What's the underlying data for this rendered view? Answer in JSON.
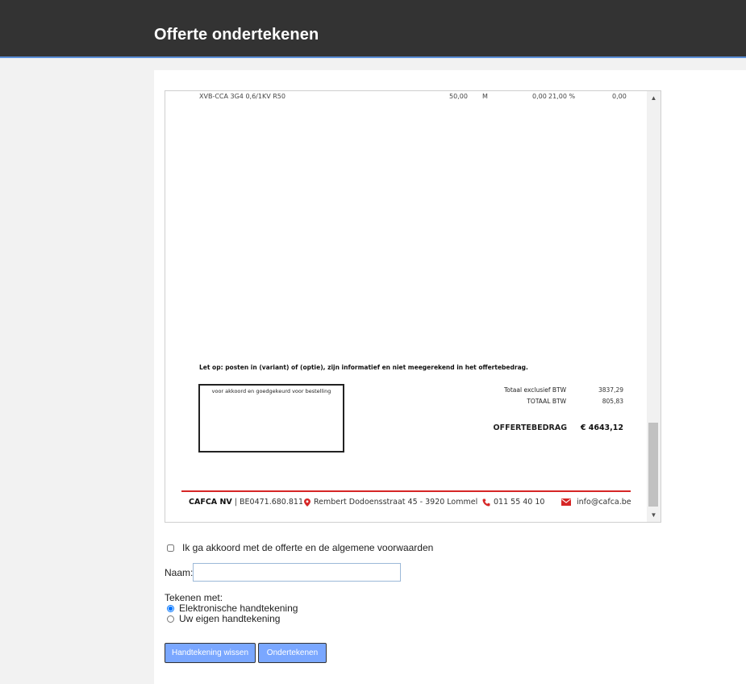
{
  "header": {
    "title": "Offerte ondertekenen"
  },
  "document": {
    "line_item": {
      "description": "XVB-CCA 3G4 0,6/1KV R50",
      "quantity": "50,00",
      "unit": "M",
      "price": "0,00",
      "vat": "21,00 %",
      "total": "0,00"
    },
    "note": "Let op: posten in (variant) of (optie), zijn informatief en niet meegerekend in het offertebedrag.",
    "sign_box_label": "voor akkoord en goedgekeurd voor bestelling",
    "totals": [
      {
        "label": "Totaal exclusief BTW",
        "value": "3837,29"
      },
      {
        "label": "TOTAAL BTW",
        "value": "805,83"
      }
    ],
    "grand_total_label": "OFFERTEBEDRAG",
    "grand_total_value": "€  4643,12",
    "footer": {
      "company": "CAFCA NV",
      "vat_number": "| BE0471.680.811",
      "address": "Rembert Dodoensstraat 45 - 3920 Lommel",
      "phone": "011 55 40 10",
      "email": "info@cafca.be",
      "accent_color": "#d62626"
    }
  },
  "form": {
    "agree_label": "Ik ga akkoord met de offerte en de algemene voorwaarden",
    "agree_checked": false,
    "name_label": "Naam:",
    "name_value": "",
    "sign_with_label": "Tekenen met:",
    "options": [
      {
        "label": "Elektronische handtekening",
        "checked": true
      },
      {
        "label": "Uw eigen handtekening",
        "checked": false
      }
    ],
    "clear_button": "Handtekening wissen",
    "submit_button": "Ondertekenen"
  },
  "colors": {
    "header_bg": "#333333",
    "button_bg": "#7aa7ff"
  }
}
